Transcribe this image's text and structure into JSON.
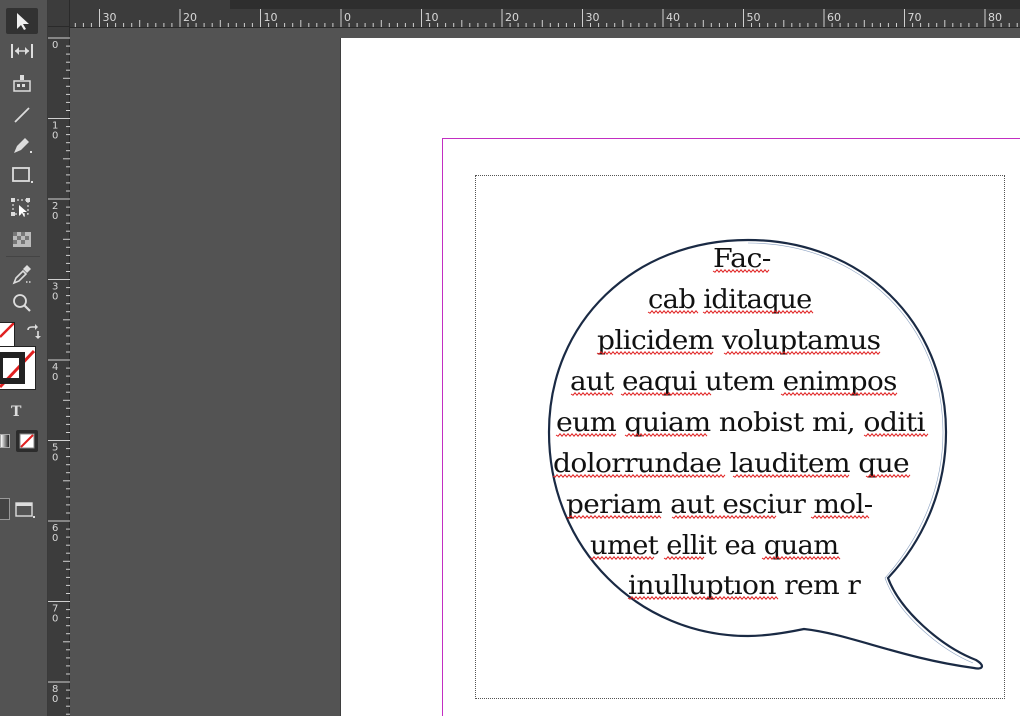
{
  "toolbar": {
    "tools": [
      {
        "name": "selection-tool",
        "icon": "arrow-cursor-icon",
        "selected": true
      },
      {
        "name": "gap-tool",
        "icon": "gap-icon"
      },
      {
        "name": "content-collector-tool",
        "icon": "content-collector-icon"
      },
      {
        "name": "line-tool",
        "icon": "line-icon"
      },
      {
        "name": "pen-tool",
        "icon": "pen-icon"
      },
      {
        "name": "rectangle-frame-tool",
        "icon": "rectangle-icon"
      },
      {
        "name": "free-transform-tool",
        "icon": "free-transform-icon"
      },
      {
        "name": "gradient-swatch-tool",
        "icon": "gradient-swatch-icon"
      },
      {
        "name": "eyedropper-tool",
        "icon": "eyedropper-icon"
      },
      {
        "name": "zoom-tool",
        "icon": "magnifier-icon"
      }
    ],
    "formatting_label": "T"
  },
  "rulers": {
    "horizontal_labels": [
      "30",
      "20",
      "10",
      "0",
      "10",
      "20",
      "30",
      "40",
      "50",
      "60",
      "70",
      "80"
    ],
    "vertical_labels": [
      "0",
      "10",
      "20",
      "30",
      "40",
      "50",
      "60",
      "70",
      "80"
    ]
  },
  "document": {
    "text_lines": [
      "Fac-",
      "cab iditaque",
      "plicidem voluptamus",
      "aut eaqui utem enimpos",
      "eum quiam nobist mi, oditi",
      "dolorrundae lauditem que",
      "periam aut esciur mol-",
      "umet ellit ea quam",
      "inulluptıon rem r"
    ]
  },
  "colors": {
    "ui_background": "#535353",
    "ruler_background": "#3c3c3c",
    "page": "#ffffff",
    "margin_guide": "#c22ec2",
    "bubble_stroke": "#1a2a44",
    "spellcheck": "#e02020"
  }
}
